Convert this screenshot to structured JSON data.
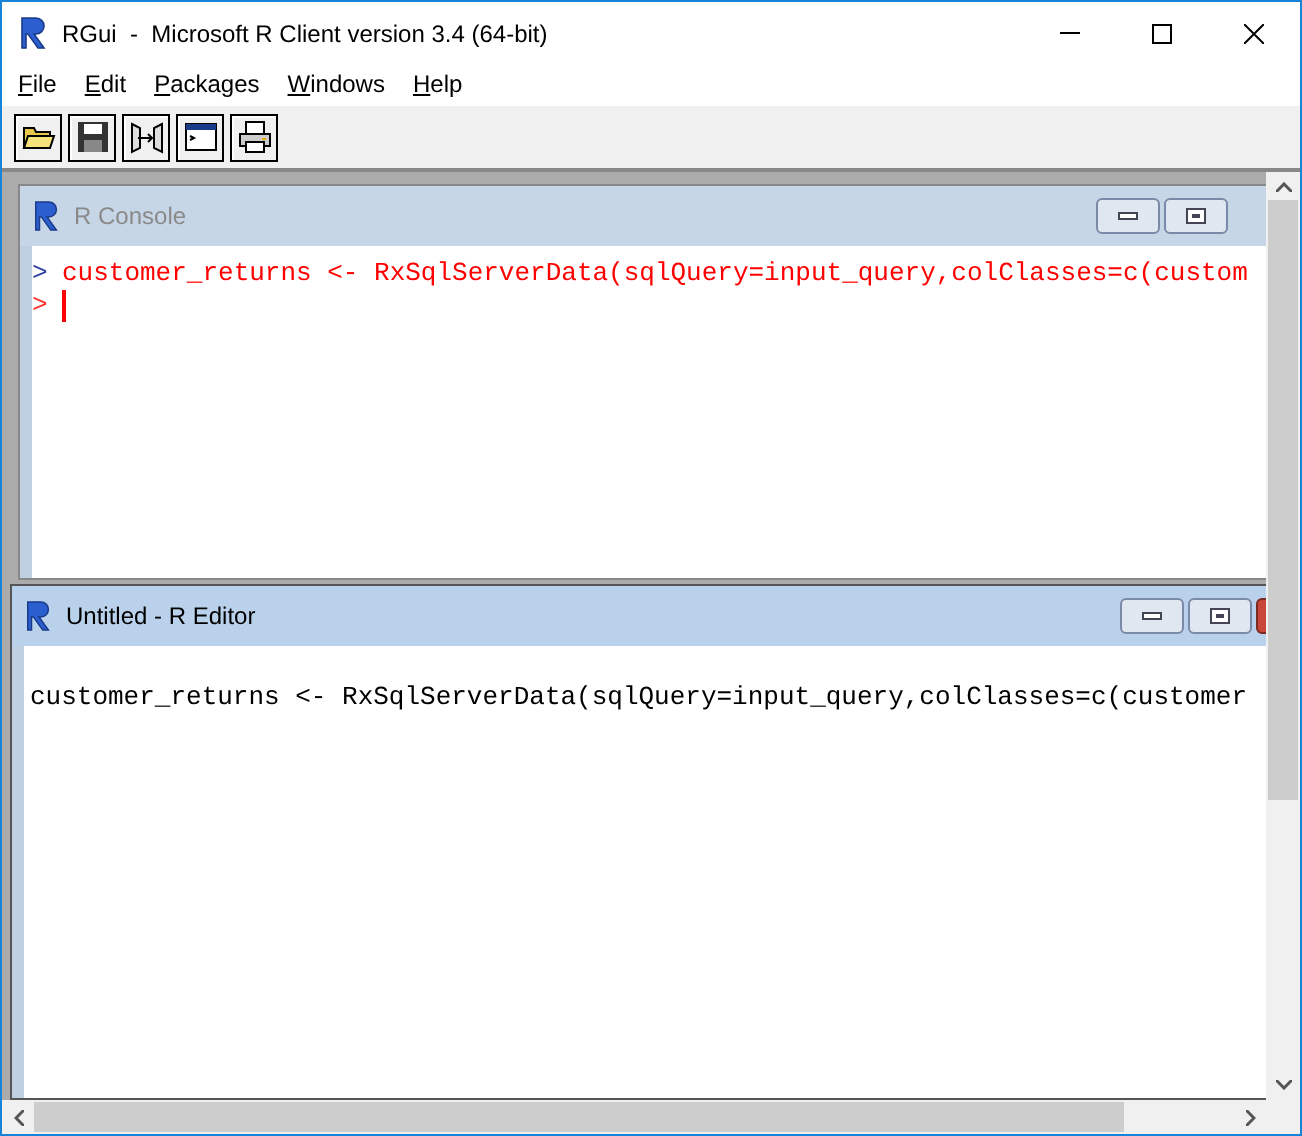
{
  "window": {
    "title": "RGui  -  Microsoft R Client version 3.4 (64-bit)"
  },
  "menu": [
    {
      "label": "File"
    },
    {
      "label": "Edit"
    },
    {
      "label": "Packages"
    },
    {
      "label": "Windows"
    },
    {
      "label": "Help"
    }
  ],
  "toolbar": [
    {
      "kind": "open"
    },
    {
      "kind": "save"
    },
    {
      "kind": "load"
    },
    {
      "kind": "console"
    },
    {
      "kind": "print"
    }
  ],
  "console": {
    "title": "R Console",
    "active": false,
    "lines": [
      {
        "prompt": ">",
        "text": "customer_returns <- RxSqlServerData(sqlQuery=input_query,colClasses=c(custom"
      },
      {
        "prompt": ">",
        "cursor": true
      }
    ]
  },
  "editor": {
    "title": "Untitled - R Editor",
    "active": true,
    "lines": [
      "customer_returns <- RxSqlServerData(sqlQuery=input_query,colClasses=c(customer"
    ]
  }
}
